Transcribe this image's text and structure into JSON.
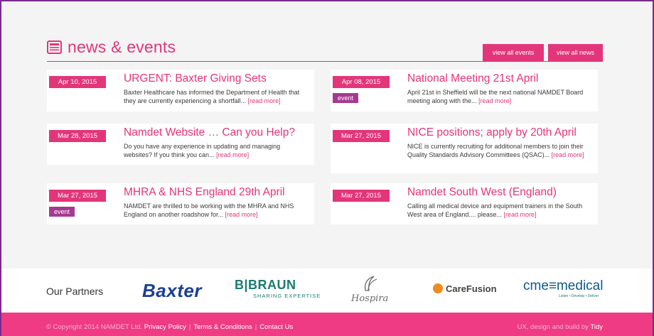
{
  "section": {
    "title": "news & events",
    "buttons": {
      "events": "view all events",
      "news": "view all news"
    }
  },
  "cards": [
    {
      "date": "Apr 10, 2015",
      "tag": "",
      "title": "URGENT: Baxter Giving Sets",
      "body": "Baxter Healthcare has informed the Department of Health that they are currently experiencing a shortfall...",
      "more": "[read more]"
    },
    {
      "date": "Apr 08, 2015",
      "tag": "event",
      "title": "National Meeting 21st April",
      "body": "April 21st in Sheffield will be the next national NAMDET Board meeting along with the...",
      "more": "[read more]"
    },
    {
      "date": "Mar 28, 2015",
      "tag": "",
      "title": "Namdet Website … Can you Help?",
      "body": "Do you have any experience in updating and managing websites? If you think you can...",
      "more": "[read more]"
    },
    {
      "date": "Mar 27, 2015",
      "tag": "",
      "title": "NICE positions; apply by 20th April",
      "body": "NICE is currently recruiting for additional members to join their Quality Standards Advisory Committees (QSAC)...",
      "more": "[read more]"
    },
    {
      "date": "Mar 27, 2015",
      "tag": "event",
      "title": "MHRA & NHS England 29th April",
      "body": "NAMDET are thrilled to be working with the MHRA and NHS England on another roadshow for...",
      "more": "[read more]"
    },
    {
      "date": "Mar 27, 2015",
      "tag": "",
      "title": "Namdet South West (England)",
      "body": "Calling all medical device and equipment trainers in the South West area of England.... please...",
      "more": "[read more]"
    }
  ],
  "partners": {
    "label": "Our Partners",
    "baxter": "Baxter",
    "braun_main": "B|BRAUN",
    "braun_sub": "SHARING EXPERTISE",
    "hospira": "Hospira",
    "carefusion": "CareFusion",
    "cme_main": "cme≡medical",
    "cme_sub": "Listen • Develop • Deliver"
  },
  "footer": {
    "copyright": "© Copyright 2014 NAMDET Ltd.",
    "privacy": "Privacy Policy",
    "terms": "Terms & Conditions",
    "contact": "Contact Us",
    "credit_prefix": "UX, design and build by",
    "credit_link": "Tidy"
  },
  "colors": {
    "accent": "#e3357a",
    "event_tag": "#a63a92",
    "footer_bg": "#ee3b84"
  }
}
